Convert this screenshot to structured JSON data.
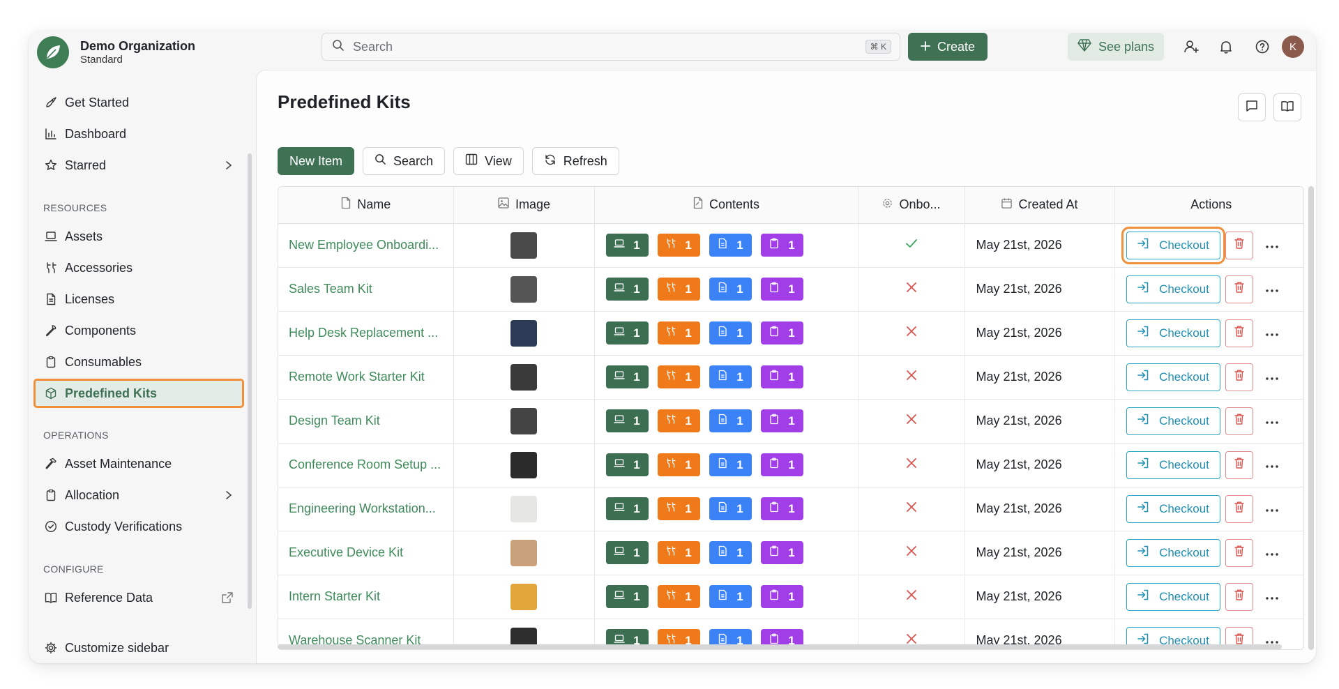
{
  "org": {
    "name": "Demo Organization",
    "plan": "Standard"
  },
  "topbar": {
    "search_placeholder": "Search",
    "search_shortcut": "⌘ K",
    "create_label": "Create",
    "plans_label": "See plans",
    "avatar_initial": "K"
  },
  "sidebar": {
    "get_started": "Get Started",
    "dashboard": "Dashboard",
    "starred": "Starred",
    "resources_title": "RESOURCES",
    "assets": "Assets",
    "accessories": "Accessories",
    "licenses": "Licenses",
    "components": "Components",
    "consumables": "Consumables",
    "predefined_kits": "Predefined Kits",
    "operations_title": "OPERATIONS",
    "asset_maintenance": "Asset Maintenance",
    "allocation": "Allocation",
    "custody_verifications": "Custody Verifications",
    "configure_title": "CONFIGURE",
    "reference_data": "Reference Data",
    "customize_sidebar": "Customize sidebar"
  },
  "page": {
    "title": "Predefined Kits"
  },
  "toolbar": {
    "new_item": "New Item",
    "search": "Search",
    "view": "View",
    "refresh": "Refresh"
  },
  "table": {
    "headers": {
      "name": "Name",
      "image": "Image",
      "contents": "Contents",
      "onboarding": "Onbo...",
      "created_at": "Created At",
      "actions": "Actions"
    },
    "checkout_label": "Checkout",
    "rows": [
      {
        "name": "New Employee Onboardi...",
        "onboarding": true,
        "created_at": "May 21st, 2026",
        "counts": [
          "1",
          "1",
          "1",
          "1"
        ],
        "thumb": "#4a4a4a"
      },
      {
        "name": "Sales Team Kit",
        "onboarding": false,
        "created_at": "May 21st, 2026",
        "counts": [
          "1",
          "1",
          "1",
          "1"
        ],
        "thumb": "#555555"
      },
      {
        "name": "Help Desk Replacement ...",
        "onboarding": false,
        "created_at": "May 21st, 2026",
        "counts": [
          "1",
          "1",
          "1",
          "1"
        ],
        "thumb": "#2d3a55"
      },
      {
        "name": "Remote Work Starter Kit",
        "onboarding": false,
        "created_at": "May 21st, 2026",
        "counts": [
          "1",
          "1",
          "1",
          "1"
        ],
        "thumb": "#3a3a3a"
      },
      {
        "name": "Design Team Kit",
        "onboarding": false,
        "created_at": "May 21st, 2026",
        "counts": [
          "1",
          "1",
          "1",
          "1"
        ],
        "thumb": "#444444"
      },
      {
        "name": "Conference Room Setup ...",
        "onboarding": false,
        "created_at": "May 21st, 2026",
        "counts": [
          "1",
          "1",
          "1",
          "1"
        ],
        "thumb": "#2b2b2b"
      },
      {
        "name": "Engineering Workstation...",
        "onboarding": false,
        "created_at": "May 21st, 2026",
        "counts": [
          "1",
          "1",
          "1",
          "1"
        ],
        "thumb": "#e6e6e2"
      },
      {
        "name": "Executive Device Kit",
        "onboarding": false,
        "created_at": "May 21st, 2026",
        "counts": [
          "1",
          "1",
          "1",
          "1"
        ],
        "thumb": "#c9a27c"
      },
      {
        "name": "Intern Starter Kit",
        "onboarding": false,
        "created_at": "May 21st, 2026",
        "counts": [
          "1",
          "1",
          "1",
          "1"
        ],
        "thumb": "#e3a63b"
      },
      {
        "name": "Warehouse Scanner Kit",
        "onboarding": false,
        "created_at": "May 21st, 2026",
        "counts": [
          "1",
          "1",
          "1",
          "1"
        ],
        "thumb": "#2e2e2e"
      }
    ]
  },
  "colors": {
    "accent": "#3f7254",
    "link": "#3f8a5a",
    "laptop_badge": "#3c6e52",
    "accessory_badge": "#f07a1a",
    "license_badge": "#3b82f6",
    "consumable_badge": "#a23ee8",
    "checkout": "#2aa6c8",
    "delete": "#d9534f",
    "highlight": "#f0903a"
  },
  "icons": {
    "contents_badges": [
      "laptop-icon",
      "accessory-icon",
      "license-icon",
      "consumable-icon"
    ]
  }
}
